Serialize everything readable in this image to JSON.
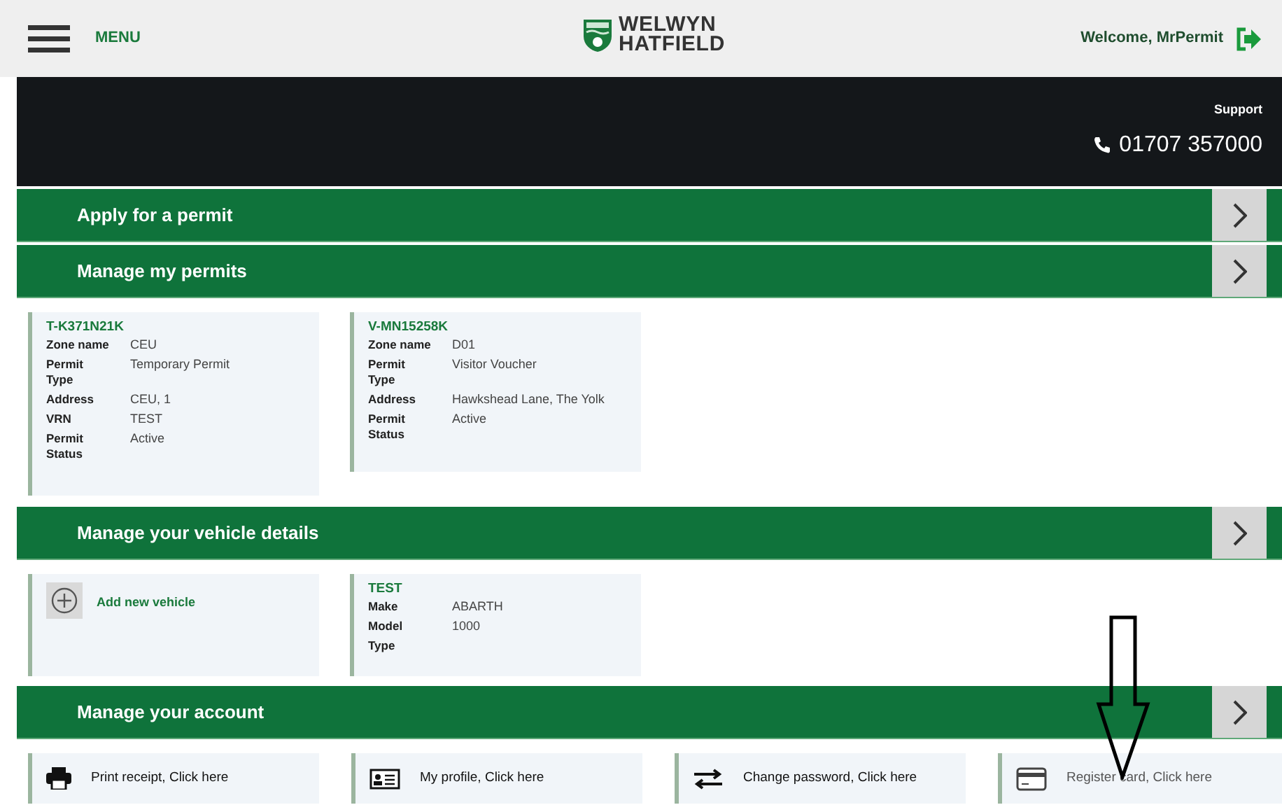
{
  "header": {
    "menu_label": "MENU",
    "logo_line_1": "WELWYN",
    "logo_line_2": "HATFIELD",
    "welcome": "Welcome, MrPermit"
  },
  "support": {
    "label": "Support",
    "phone": "01707 357000"
  },
  "sections": [
    {
      "title": "Apply for a permit",
      "kind": "empty"
    },
    {
      "title": "Manage my permits",
      "kind": "permits",
      "cards": [
        {
          "title": "T-K371N21K",
          "fields": [
            {
              "label": "Zone name",
              "value": "CEU"
            },
            {
              "label": "Permit Type",
              "value": "Temporary Permit"
            },
            {
              "label": "Address",
              "value": "CEU, 1"
            },
            {
              "label": "VRN",
              "value": "TEST"
            },
            {
              "label": "Permit Status",
              "value": "Active"
            }
          ]
        },
        {
          "title": "V-MN15258K",
          "fields": [
            {
              "label": "Zone name",
              "value": "D01"
            },
            {
              "label": "Permit Type",
              "value": "Visitor Voucher"
            },
            {
              "label": "Address",
              "value": "Hawkshead Lane, The Yolk"
            },
            {
              "label": "Permit Status",
              "value": "Active"
            }
          ]
        }
      ]
    },
    {
      "title": "Manage your vehicle details",
      "kind": "vehicles",
      "add_label": "Add new vehicle",
      "cards": [
        {
          "title": "TEST",
          "fields": [
            {
              "label": "Make",
              "value": "ABARTH"
            },
            {
              "label": "Model",
              "value": "1000"
            },
            {
              "label": "Type"
            }
          ]
        }
      ]
    },
    {
      "title": "Manage your account",
      "kind": "account",
      "links": [
        {
          "label": "Print receipt, Click here",
          "kind": "printer"
        },
        {
          "label": "My profile, Click here",
          "kind": "id-card"
        },
        {
          "label": "Change password, Click here",
          "kind": "swap"
        },
        {
          "label": "Register card, Click here",
          "kind": "card"
        }
      ]
    }
  ]
}
